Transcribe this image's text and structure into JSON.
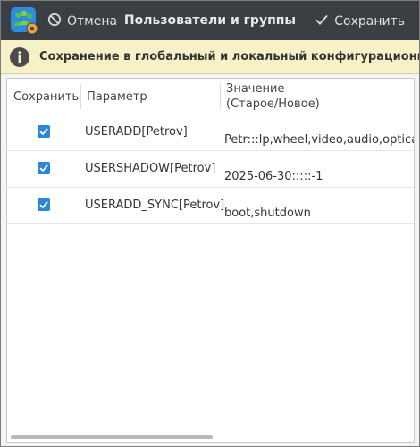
{
  "header": {
    "cancel_label": "Отмена",
    "title": "Пользователи и группы",
    "save_label": "Сохранить"
  },
  "infobar": {
    "text": "Сохранение в глобальный и локальный конфигурационный файл"
  },
  "table": {
    "columns": {
      "save": "Сохранить",
      "param": "Параметр",
      "value_line1": "Значение",
      "value_line2": "(Старое/Новое)"
    },
    "rows": [
      {
        "checked": true,
        "param": "USERADD[Petrov]",
        "value": "Petr:::lp,wheel,video,audio,optical,st"
      },
      {
        "checked": true,
        "param": "USERSHADOW[Petrov]",
        "value": "2025-06-30:::::-1"
      },
      {
        "checked": true,
        "param": "USERADD_SYNC[Petrov]",
        "value": "boot,shutdown"
      }
    ]
  },
  "colors": {
    "headerbar": "#3b3f44",
    "infobar": "#f6f1c6",
    "checkbox": "#2b86d8"
  },
  "icons": [
    "users-settings-app-icon",
    "cancel-icon",
    "checkmark-icon",
    "info-icon"
  ]
}
